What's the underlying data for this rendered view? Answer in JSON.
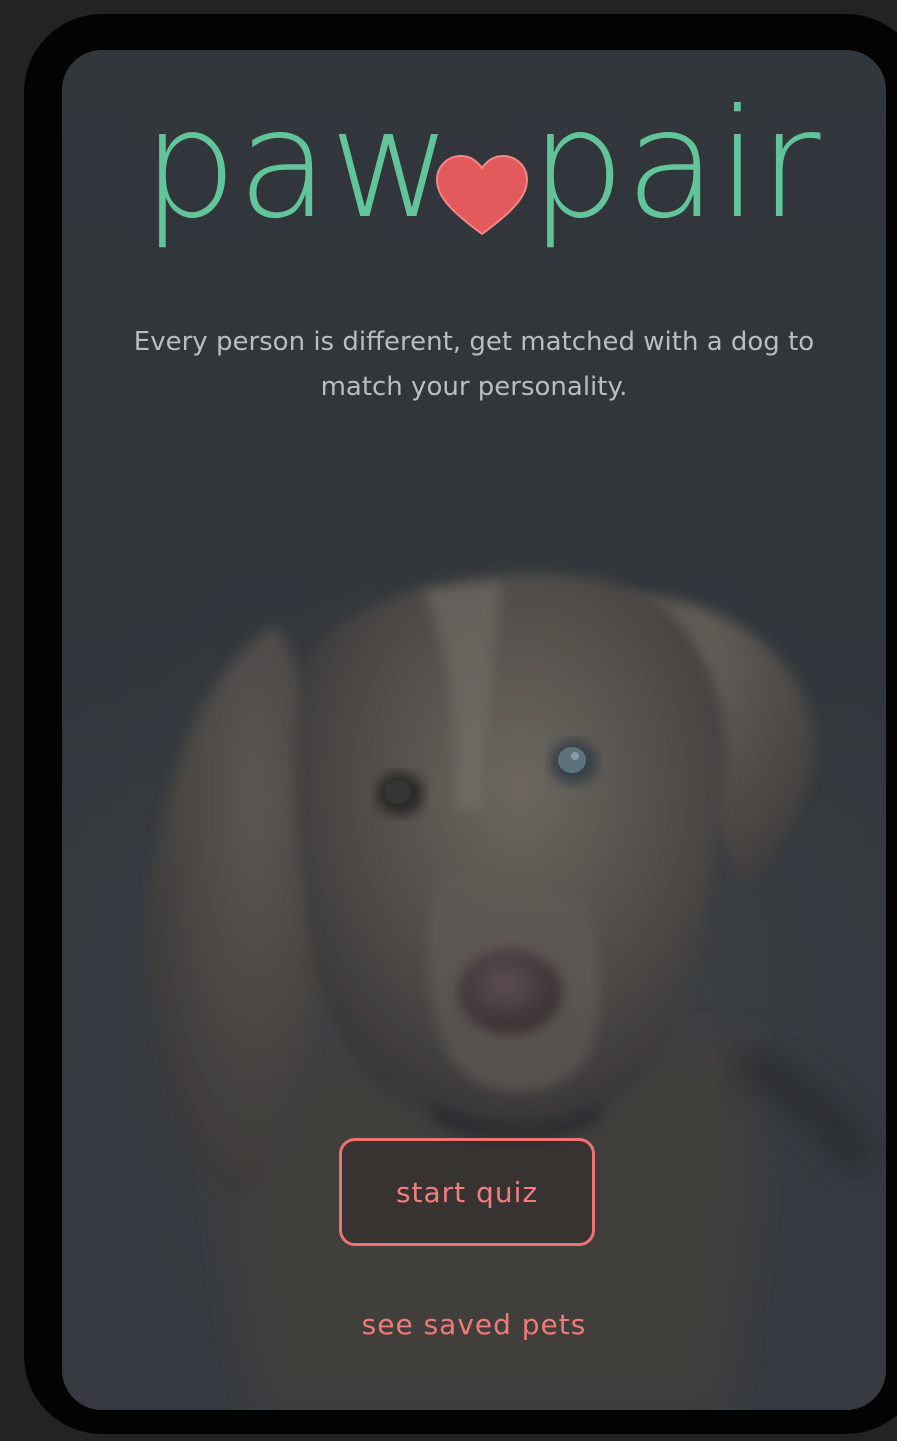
{
  "brand": {
    "logo_left": "paw",
    "logo_right": "pair",
    "logo_color": "#62c59a",
    "heart_color": "#e45a5c",
    "heart_icon": "heart-icon"
  },
  "hero": {
    "tagline": "Every person is different, get matched with a dog to match your personality.",
    "image": "dog-photo"
  },
  "actions": {
    "start_label": "start quiz",
    "saved_label": "see saved pets",
    "accent_color": "#ef7373"
  }
}
